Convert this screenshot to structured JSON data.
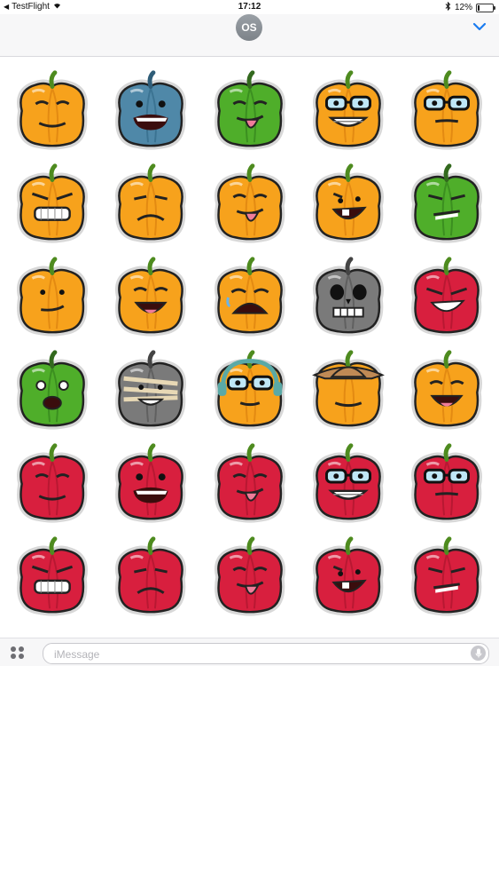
{
  "status_bar": {
    "app_name": "TestFlight",
    "time": "17:12",
    "battery_text": "12%",
    "battery_level": 0.12
  },
  "conversation": {
    "avatar_initials": "OS"
  },
  "icons": {
    "wifi": "wifi-icon",
    "bluetooth": "bluetooth-icon",
    "battery": "battery-icon",
    "collapse": "chevron-down-icon",
    "apps": "app-drawer-icon",
    "mic": "microphone-icon"
  },
  "colors": {
    "accent": "#1a7cf0",
    "orange": "#f7a21c",
    "green": "#4fae2a",
    "blue_grey": "#4f88a8",
    "red": "#d81f3e",
    "grey": "#7a7a7a"
  },
  "stickers": [
    [
      {
        "name": "pumpkin-content",
        "color": "orange",
        "face": "content"
      },
      {
        "name": "pumpkin-blue-monster",
        "color": "blue_grey",
        "face": "scared"
      },
      {
        "name": "pumpkin-green-tongue",
        "color": "green",
        "face": "tongue"
      },
      {
        "name": "pumpkin-braces-glasses",
        "color": "orange",
        "face": "braces"
      },
      {
        "name": "pumpkin-nerd-glasses",
        "color": "orange",
        "face": "nerd"
      }
    ],
    [
      {
        "name": "pumpkin-angry-headband",
        "color": "orange",
        "face": "angry"
      },
      {
        "name": "pumpkin-frown",
        "color": "orange",
        "face": "frown"
      },
      {
        "name": "pumpkin-tongue",
        "color": "orange",
        "face": "tongue"
      },
      {
        "name": "pumpkin-grin",
        "color": "orange",
        "face": "grin"
      },
      {
        "name": "pumpkin-green-grimace",
        "color": "green",
        "face": "grimace"
      }
    ],
    [
      {
        "name": "pumpkin-smug",
        "color": "orange",
        "face": "smug"
      },
      {
        "name": "pumpkin-robin-hood",
        "color": "orange",
        "face": "happy"
      },
      {
        "name": "pumpkin-crying",
        "color": "orange",
        "face": "crying"
      },
      {
        "name": "pumpkin-skull",
        "color": "grey",
        "face": "skull"
      },
      {
        "name": "pumpkin-devil",
        "color": "red",
        "face": "devil"
      }
    ],
    [
      {
        "name": "pumpkin-zombie",
        "color": "green",
        "face": "zombie"
      },
      {
        "name": "pumpkin-mummy",
        "color": "grey",
        "face": "mummy"
      },
      {
        "name": "pumpkin-headphones",
        "color": "orange",
        "face": "headphones"
      },
      {
        "name": "pumpkin-cowboy",
        "color": "orange",
        "face": "cowboy"
      },
      {
        "name": "pumpkin-candy-hair",
        "color": "orange",
        "face": "happy"
      }
    ],
    [
      {
        "name": "apple-content",
        "color": "red",
        "face": "content"
      },
      {
        "name": "apple-scared",
        "color": "red",
        "face": "scared"
      },
      {
        "name": "apple-tongue-side",
        "color": "red",
        "face": "tongue"
      },
      {
        "name": "apple-braces-glasses",
        "color": "red",
        "face": "braces"
      },
      {
        "name": "apple-nerd-glasses",
        "color": "red",
        "face": "nerd"
      }
    ],
    [
      {
        "name": "apple-angry-headband",
        "color": "red",
        "face": "angry"
      },
      {
        "name": "apple-frown",
        "color": "red",
        "face": "frown"
      },
      {
        "name": "apple-tongue",
        "color": "red",
        "face": "tongue"
      },
      {
        "name": "apple-grin",
        "color": "red",
        "face": "grin"
      },
      {
        "name": "apple-grimace",
        "color": "red",
        "face": "grimace"
      }
    ]
  ],
  "message_input": {
    "placeholder": "iMessage",
    "value": ""
  }
}
